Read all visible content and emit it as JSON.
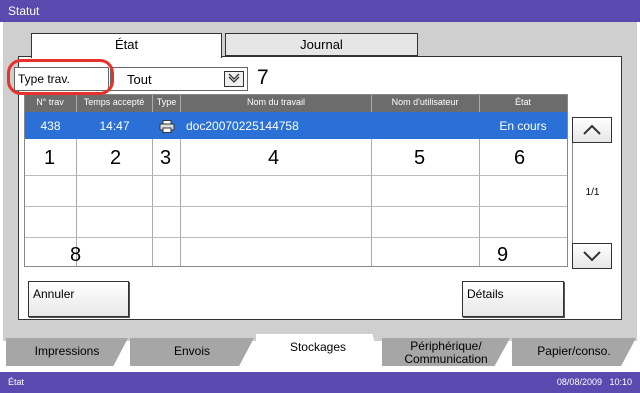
{
  "window": {
    "title": "Statut"
  },
  "top_tabs": {
    "state": "État",
    "journal": "Journal"
  },
  "filter": {
    "label": "Type trav.",
    "value": "Tout"
  },
  "callouts": {
    "c1": "1",
    "c2": "2",
    "c3": "3",
    "c4": "4",
    "c5": "5",
    "c6": "6",
    "c7": "7",
    "c8": "8",
    "c9": "9"
  },
  "table": {
    "headers": [
      "N° trav",
      "Temps accepté",
      "Type",
      "Nom du travail",
      "Nom d'utilisateur",
      "État"
    ],
    "rows": [
      {
        "job_no": "438",
        "time": "14:47",
        "type_icon": "printer-icon",
        "name": "doc20070225144758",
        "user": "",
        "status": "En cours"
      }
    ]
  },
  "pagination": {
    "page": "1/1"
  },
  "buttons": {
    "cancel": "Annuler",
    "details": "Détails"
  },
  "bottom_tabs": {
    "impressions": "Impressions",
    "envois": "Envois",
    "stockages": "Stockages",
    "peripherique_line1": "Périphérique/",
    "peripherique_line2": "Communication",
    "papier": "Papier/conso."
  },
  "statusbar": {
    "left": "État",
    "datetime": "08/08/2009   10:10"
  },
  "colors": {
    "titlebar": "#5a4ab0",
    "selected_row": "#2a70d6",
    "highlight": "#e8312a",
    "panel": "#cfcfcf"
  }
}
